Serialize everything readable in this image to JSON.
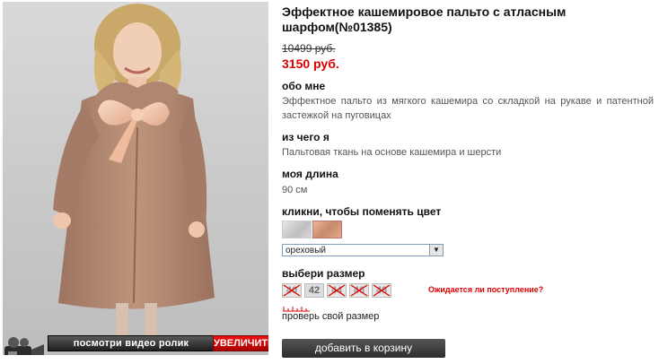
{
  "product": {
    "title": "Эффектное кашемировое пальто с атласным шарфом(№01385)",
    "old_price": "10499 руб.",
    "new_price": "3150 руб."
  },
  "photo": {
    "video_label": "посмотри видео ролик",
    "zoom_label": "УВЕЛИЧИТЬ"
  },
  "about": {
    "heading": "обо мне",
    "text": "Эффектное пальто из мягкого кашемира со складкой на рукаве и патентной застежкой на пуговицах"
  },
  "material": {
    "heading": "из чего я",
    "text": "Пальтовая ткань на основе кашемира и шерсти"
  },
  "length": {
    "heading": "моя длина",
    "text": "90 см"
  },
  "color": {
    "heading": "кликни, чтобы поменять цвет",
    "selected": "ореховый",
    "swatches": [
      "grey-swatch",
      "nut-swatch"
    ]
  },
  "size": {
    "heading": "выбери размер",
    "sizes": [
      {
        "label": "40",
        "available": false
      },
      {
        "label": "42",
        "available": true
      },
      {
        "label": "44",
        "available": false
      },
      {
        "label": "46",
        "available": false
      },
      {
        "label": "48",
        "available": false
      }
    ],
    "await_label": "Ожидается ли поступление?",
    "check_label": "проверь свой размер"
  },
  "cart": {
    "button_label": "добавить в корзину"
  },
  "colors": {
    "price_red": "#dd0000",
    "button_dark": "#333333",
    "coat": "#b98e74"
  }
}
